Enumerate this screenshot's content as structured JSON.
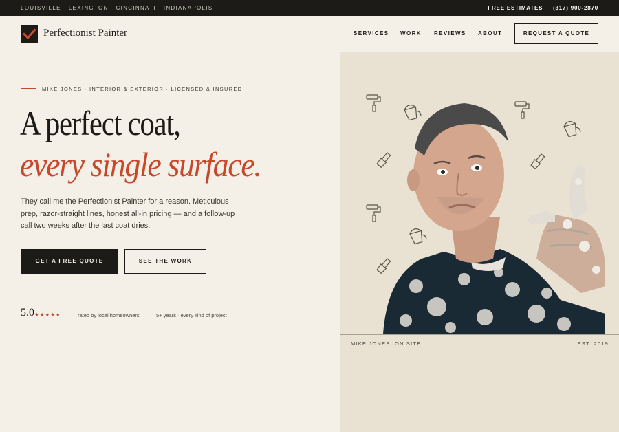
{
  "topbar": {
    "cities": "LOUISVILLE · LEXINGTON · CINCINNATI · INDIANAPOLIS",
    "phone": "FREE ESTIMATES — (317) 900-2870"
  },
  "brand": {
    "name": "Perfectionist Painter",
    "logo_icon": "checkmark-icon",
    "accent_color": "#c9482a",
    "dark_color": "#1d1b17"
  },
  "nav": {
    "links": [
      "SERVICES",
      "WORK",
      "REVIEWS",
      "ABOUT"
    ],
    "cta": "REQUEST A QUOTE"
  },
  "hero": {
    "eyebrow": "MIKE JONES · INTERIOR & EXTERIOR · LICENSED & INSURED",
    "headline_line1": "A perfect coat,",
    "headline_line2": "every single surface.",
    "lede": "They call me the Perfectionist Painter for a reason. Meticulous prep, razor-straight lines, honest all-in pricing — and a follow-up call two weeks after the last coat dries.",
    "primary_cta": "GET A FREE QUOTE",
    "secondary_cta": "SEE THE WORK",
    "rating": "5.0",
    "stars": "★★★★★",
    "rated_text": "rated by local homeowners",
    "years_text": "5+ years · every kind of project"
  },
  "photo": {
    "caption_left": "MIKE JONES, ON SITE",
    "caption_right": "EST. 2019",
    "doodle_icons": [
      "paint-roller-icon",
      "paint-bucket-icon",
      "paintbrush-icon"
    ]
  }
}
